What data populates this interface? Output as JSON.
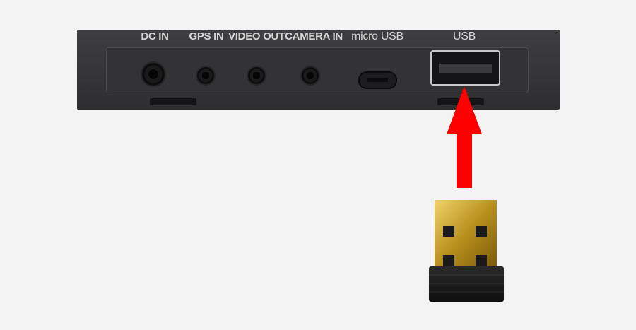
{
  "panel": {
    "ports": [
      {
        "id": "dc-in",
        "label": "DC IN"
      },
      {
        "id": "gps-in",
        "label": "GPS IN"
      },
      {
        "id": "video-out",
        "label": "VIDEO OUT"
      },
      {
        "id": "camera-in",
        "label": "CAMERA IN"
      },
      {
        "id": "micro-usb",
        "label": "micro USB"
      },
      {
        "id": "usb",
        "label": "USB"
      }
    ]
  },
  "colors": {
    "panel": "#38383a",
    "arrow": "#ff0000",
    "connector_gold": "#c9a227",
    "background": "#f3f3f3"
  },
  "icons": {
    "arrow": "arrow-up-icon",
    "dongle": "usb-dongle-icon"
  }
}
